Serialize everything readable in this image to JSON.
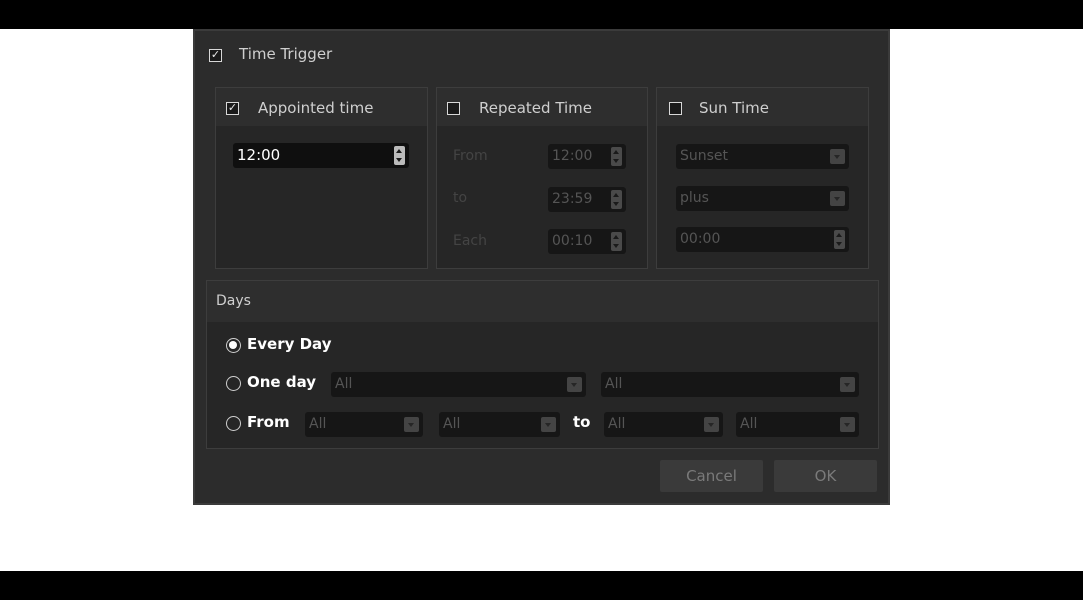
{
  "dialog": {
    "title": "Time Trigger",
    "title_checked": true
  },
  "appointed": {
    "label": "Appointed time",
    "checked": true,
    "value": "12:00"
  },
  "repeated": {
    "label": "Repeated Time",
    "checked": false,
    "from_label": "From",
    "from_value": "12:00",
    "to_label": "to",
    "to_value": "23:59",
    "each_label": "Each",
    "each_value": "00:10"
  },
  "sun": {
    "label": "Sun Time",
    "checked": false,
    "event_value": "Sunset",
    "mode_value": "plus",
    "offset_value": "00:00"
  },
  "days": {
    "title": "Days",
    "every_day_label": "Every Day",
    "one_day_label": "One day",
    "one_day_select_1": "All",
    "one_day_select_2": "All",
    "from_label": "From",
    "from_select_1": "All",
    "from_select_2": "All",
    "to_label": "to",
    "to_select_1": "All",
    "to_select_2": "All",
    "selected": "Every Day"
  },
  "buttons": {
    "cancel": "Cancel",
    "ok": "OK"
  }
}
